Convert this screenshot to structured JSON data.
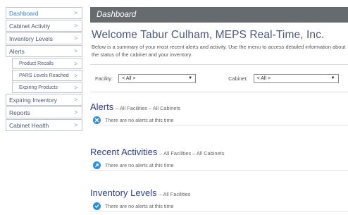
{
  "sidebar": {
    "items": [
      {
        "label": "Dashboard",
        "active": true,
        "sub": false
      },
      {
        "label": "Cabinet Activity",
        "active": false,
        "sub": false
      },
      {
        "label": "Inventory Levels",
        "active": false,
        "sub": false
      },
      {
        "label": "Alerts",
        "active": false,
        "sub": false
      },
      {
        "label": "Product Recalls",
        "active": false,
        "sub": true
      },
      {
        "label": "PARS Levels Reached",
        "active": false,
        "sub": true
      },
      {
        "label": "Expiring Products",
        "active": false,
        "sub": true
      },
      {
        "label": "Expiring Inventory",
        "active": false,
        "sub": false
      },
      {
        "label": "Reports",
        "active": false,
        "sub": false
      },
      {
        "label": "Cabinet Health",
        "active": false,
        "sub": false
      }
    ],
    "chevron": ">"
  },
  "header": {
    "title": "Dashboard",
    "welcome": "Welcome Tabur Culham, MEPS Real-Time, Inc.",
    "summary": "Below is a summary of your most recent alerts and activity. Use the menu to access detailed information about the status of the cabinet and your inventory."
  },
  "filters": {
    "facility_label": "Facility:",
    "facility_value": "< All >",
    "cabinet_label": "Cabinet:",
    "cabinet_value": "< All >"
  },
  "sections": [
    {
      "title": "Alerts",
      "subtitle": "– All Facilities  –  All Cabinets",
      "message": "There are no alerts at this time",
      "icon": "close-icon",
      "color": "#2d8fe0"
    },
    {
      "title": "Recent Activities",
      "subtitle": "– All Facilities  –  All Cabinets",
      "message": "There are no alerts at this time",
      "icon": "arrow-icon",
      "color": "#2d8fe0"
    },
    {
      "title": "Inventory Levels",
      "subtitle": "– All Facilities",
      "message": "There are no alerts at this time",
      "icon": "check-icon",
      "color": "#2d8fe0"
    }
  ]
}
